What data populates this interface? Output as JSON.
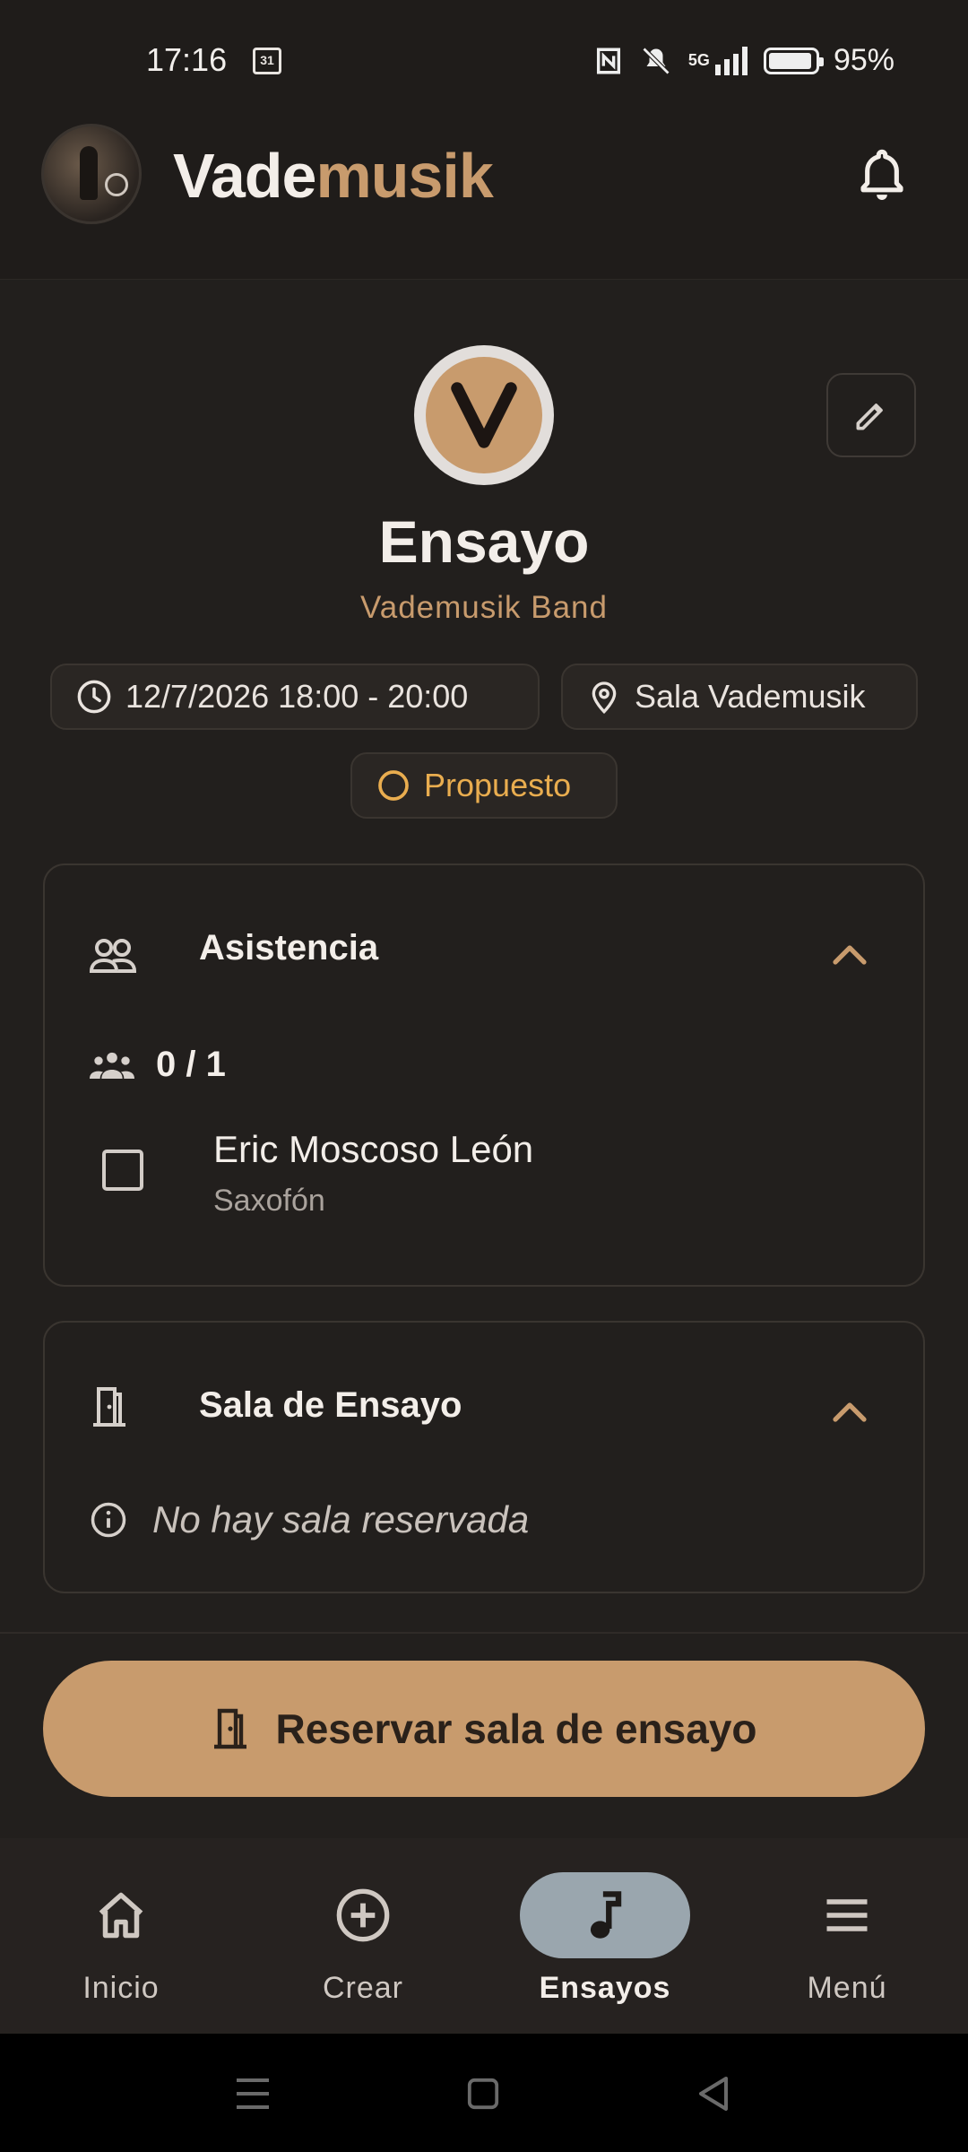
{
  "status_bar": {
    "time": "17:16",
    "calendar_day": "31",
    "network": "5G",
    "battery": "95%",
    "battery_level": 0.95
  },
  "header": {
    "brand_part1": "Vade",
    "brand_part2": "musik",
    "colors": {
      "accent": "#c89b6d",
      "background": "#221f1d"
    }
  },
  "event": {
    "title": "Ensayo",
    "band": "Vademusik Band",
    "datetime": "12/7/2026 18:00 - 20:00",
    "location": "Sala Vademusik",
    "status": "Propuesto",
    "status_color": "#e9ad4f"
  },
  "attendance": {
    "title": "Asistencia",
    "count": "0 / 1",
    "members": [
      {
        "name": "Eric Moscoso León",
        "role": "Saxofón"
      }
    ]
  },
  "room": {
    "title": "Sala de Ensayo",
    "empty_text": "No hay sala reservada"
  },
  "cta": {
    "label": "Reservar sala de ensayo"
  },
  "nav": {
    "items": [
      {
        "label": "Inicio",
        "icon": "home-icon"
      },
      {
        "label": "Crear",
        "icon": "add-circle-icon"
      },
      {
        "label": "Ensayos",
        "icon": "music-note-icon"
      },
      {
        "label": "Menú",
        "icon": "menu-icon"
      }
    ],
    "active": "Ensayos"
  }
}
